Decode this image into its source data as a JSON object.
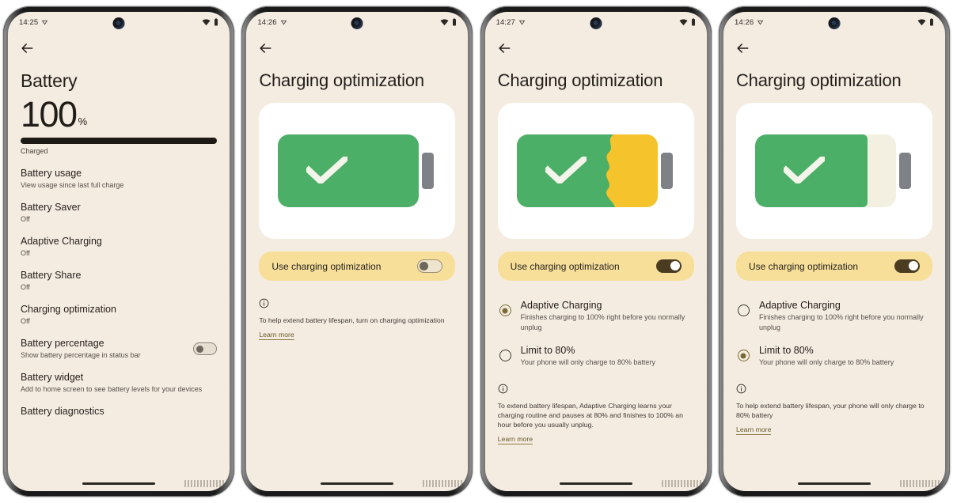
{
  "colors": {
    "screen_bg": "#f4ece1",
    "card_bg": "#ffffff",
    "banner_bg": "#f7df9a",
    "battery_green": "#4caf68",
    "battery_yellow": "#f5c32c",
    "battery_tip": "#7e8287",
    "battery_empty": "#f3f0e2",
    "toggle_on_track": "#4a3c20",
    "link": "#6a5a2a",
    "text_primary": "#221f1b",
    "text_secondary": "#55504a"
  },
  "icons": {
    "back": "back-arrow-icon",
    "info": "info-icon",
    "wifi": "wifi-icon",
    "battery": "battery-status-icon",
    "signal": "signal-icon",
    "camera": "front-camera-punch-hole",
    "check": "checkmark-icon"
  },
  "screens": [
    {
      "id": "battery-overview",
      "status": {
        "time": "14:25",
        "wifi": "wifi-icon",
        "battery": "battery-status-icon"
      },
      "title": "Battery",
      "percent": "100",
      "percent_symbol": "%",
      "charge_state": "Charged",
      "progress": 100,
      "items": [
        {
          "title": "Battery usage",
          "sub": "View usage since last full charge",
          "toggle": null
        },
        {
          "title": "Battery Saver",
          "sub": "Off",
          "toggle": null
        },
        {
          "title": "Adaptive Charging",
          "sub": "Off",
          "toggle": null
        },
        {
          "title": "Battery Share",
          "sub": "Off",
          "toggle": null
        },
        {
          "title": "Charging optimization",
          "sub": "Off",
          "toggle": null
        },
        {
          "title": "Battery percentage",
          "sub": "Show battery percentage in status bar",
          "toggle": "off"
        },
        {
          "title": "Battery widget",
          "sub": "Add to home screen to see battery levels for your devices",
          "toggle": null
        },
        {
          "title": "Battery diagnostics",
          "sub": "",
          "toggle": null
        }
      ]
    },
    {
      "id": "charging-optimization-off",
      "status": {
        "time": "14:26"
      },
      "title": "Charging optimization",
      "battery_illustration": {
        "green_pct": 100,
        "yellow_pct": 0,
        "style": "full-green"
      },
      "banner": {
        "label": "Use charging optimization",
        "toggle": "off"
      },
      "options": [],
      "info_text": "To help extend battery lifespan, turn on charging optimization",
      "learn_more": "Learn more"
    },
    {
      "id": "charging-optimization-adaptive",
      "status": {
        "time": "14:27"
      },
      "title": "Charging optimization",
      "battery_illustration": {
        "green_pct": 72,
        "yellow_pct": 28,
        "style": "green-yellow-wave"
      },
      "banner": {
        "label": "Use charging optimization",
        "toggle": "on"
      },
      "options": [
        {
          "title": "Adaptive Charging",
          "sub": "Finishes charging to 100% right before you normally unplug",
          "selected": true
        },
        {
          "title": "Limit to 80%",
          "sub": "Your phone will only charge to 80% battery",
          "selected": false
        }
      ],
      "info_text": "To extend battery lifespan, Adaptive Charging learns your charging routine and pauses at 80% and finishes to 100% an hour before you usually unplug.",
      "learn_more": "Learn more"
    },
    {
      "id": "charging-optimization-limit80",
      "status": {
        "time": "14:26"
      },
      "title": "Charging optimization",
      "battery_illustration": {
        "green_pct": 80,
        "yellow_pct": 0,
        "style": "green-empty"
      },
      "banner": {
        "label": "Use charging optimization",
        "toggle": "on"
      },
      "options": [
        {
          "title": "Adaptive Charging",
          "sub": "Finishes charging to 100% right before you normally unplug",
          "selected": false
        },
        {
          "title": "Limit to 80%",
          "sub": "Your phone will only charge to 80% battery",
          "selected": true
        }
      ],
      "info_text": "To help extend battery lifespan, your phone will only charge to 80% battery",
      "learn_more": "Learn more"
    }
  ]
}
